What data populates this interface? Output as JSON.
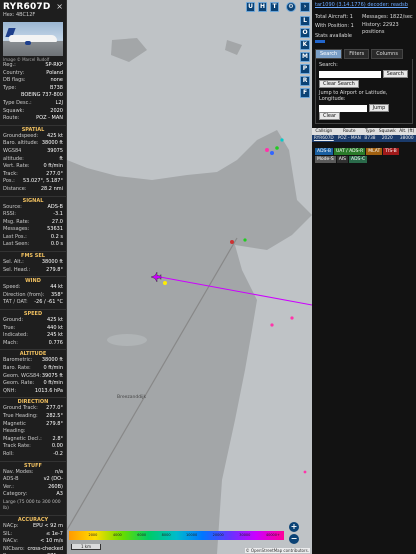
{
  "aircraft": {
    "callsign": "RYR607D",
    "hex_label": "Hex:",
    "hex": "4BC12F",
    "close": "×",
    "photo_credit": "Image © Marcel Rudolf"
  },
  "info_rows": [
    {
      "k": "Reg.:",
      "v": "SP-RKP"
    },
    {
      "k": "Country:",
      "v": "Poland"
    },
    {
      "k": "DB flags:",
      "v": "none"
    },
    {
      "k": "Type:",
      "v": "B738"
    },
    {
      "k": "",
      "v": "BOEING 737-800"
    },
    {
      "k": "Type Desc.:",
      "v": "L2J"
    },
    {
      "k": "Squawk:",
      "v": "2020"
    },
    {
      "k": "Route:",
      "v": "POZ - MAN"
    }
  ],
  "sections": {
    "spatial": {
      "title": "SPATIAL",
      "rows": [
        {
          "k": "Groundspeed:",
          "v": "425 kt"
        },
        {
          "k": "Baro. altitude:",
          "v": "38000 ft"
        },
        {
          "k": "WGS84 altitude:",
          "v": "39075 ft"
        },
        {
          "k": "Vert. Rate:",
          "v": "0 ft/min"
        },
        {
          "k": "Track:",
          "v": "277.0°"
        },
        {
          "k": "Pos.:",
          "v": "53.027°, 5.187°"
        },
        {
          "k": "Distance:",
          "v": "28.2 nmi"
        }
      ]
    },
    "signal": {
      "title": "SIGNAL",
      "rows": [
        {
          "k": "Source:",
          "v": "ADS-B"
        },
        {
          "k": "RSSI:",
          "v": "-3.1"
        },
        {
          "k": "Msg. Rate:",
          "v": "27.0"
        },
        {
          "k": "Messages:",
          "v": "53631"
        },
        {
          "k": "Last Pos.:",
          "v": "0.2 s"
        },
        {
          "k": "Last Seen:",
          "v": "0.0 s"
        }
      ]
    },
    "fms": {
      "title": "FMS SEL",
      "rows": [
        {
          "k": "Sel. Alt.:",
          "v": "38000 ft"
        },
        {
          "k": "Sel. Head.:",
          "v": "279.8°"
        }
      ]
    },
    "wind": {
      "title": "WIND",
      "rows": [
        {
          "k": "Speed:",
          "v": "44 kt"
        },
        {
          "k": "Direction (from):",
          "v": "358°"
        },
        {
          "k": "TAT / OAT:",
          "v": "-26 / -61 °C"
        }
      ]
    },
    "speed": {
      "title": "SPEED",
      "rows": [
        {
          "k": "Ground:",
          "v": "425 kt"
        },
        {
          "k": "True:",
          "v": "440 kt"
        },
        {
          "k": "Indicated:",
          "v": "245 kt"
        },
        {
          "k": "Mach:",
          "v": "0.776"
        }
      ]
    },
    "altitude": {
      "title": "ALTITUDE",
      "rows": [
        {
          "k": "Barometric:",
          "v": "38000 ft"
        },
        {
          "k": "Baro. Rate:",
          "v": "0 ft/min"
        },
        {
          "k": "Geom. WGS84:",
          "v": "39075 ft"
        },
        {
          "k": "Geom. Rate:",
          "v": "0 ft/min"
        },
        {
          "k": "QNH:",
          "v": "1013.6 hPa"
        }
      ]
    },
    "direction": {
      "title": "DIRECTION",
      "rows": [
        {
          "k": "Ground Track:",
          "v": "277.0°"
        },
        {
          "k": "True Heading:",
          "v": "282.5°"
        },
        {
          "k": "Magnetic Heading:",
          "v": "279.8°"
        },
        {
          "k": "Magnetic Decl.:",
          "v": "2.8°"
        },
        {
          "k": "Track Rate:",
          "v": "0.00"
        },
        {
          "k": "Roll:",
          "v": "-0.2"
        }
      ]
    },
    "stuff": {
      "title": "STUFF",
      "rows": [
        {
          "k": "Nav. Modes:",
          "v": "n/a"
        },
        {
          "k": "ADS-B Ver.:",
          "v": "v2 (DO-260B)"
        },
        {
          "k": "Category:",
          "v": "A3"
        }
      ],
      "note": "Large (75 000 to 300 000 lb)"
    },
    "accuracy": {
      "title": "ACCURACY",
      "rows": [
        {
          "k": "NACp:",
          "v": "EPU < 92 m"
        },
        {
          "k": "SIL:",
          "v": "≤ 1e-7"
        },
        {
          "k": "NACv:",
          "v": "< 10 m/s"
        },
        {
          "k": "NICbaro:",
          "v": "cross-checked"
        },
        {
          "k": "Rc:",
          "v": "371 m"
        }
      ],
      "note": "Learn more about Mode S data type by hovering over each data label."
    }
  },
  "map": {
    "top_buttons": [
      "U",
      "H",
      "T"
    ],
    "side_buttons": [
      "L",
      "O",
      "K",
      "M",
      "P",
      "R",
      "F"
    ],
    "zoom_in": "+",
    "zoom_out": "−",
    "place_label": "Breezanddijk",
    "altitude_scale": [
      "",
      "2000",
      "4000",
      "6000",
      "8000",
      "10000",
      "20000",
      "30000",
      "40000+"
    ],
    "scale_label": "1 km",
    "attribution": "© OpenStreetMap contributors.",
    "colors": {
      "water": "#a3a6a8",
      "land": "#bfc3c6",
      "track": "#cc00ff"
    }
  },
  "right": {
    "top_line": "tar1090 (3.14.1776) decoder: readsb",
    "total_label": "Total Aircraft: 1",
    "messages_label": "Messages: 1822/sec",
    "with_pos_label": "With Position: 1",
    "history_label": "History: 22923 positions",
    "stats_label": "Stats available",
    "tabs": [
      "Search",
      "Filters",
      "Columns"
    ],
    "search_label": "Search:",
    "search_btn": "Search",
    "clear_btn": "Clear Search",
    "jump_label": "Jump to Airport or Latitude, Longitude:",
    "jump_btn": "Jump",
    "clear2_btn": "Clear",
    "columns": [
      "Callsign",
      "Route",
      "Type",
      "Squawk",
      "Alt. (ft)"
    ],
    "rows": [
      {
        "callsign": "RYR607D",
        "route": "POZ - MAN",
        "type": "B738",
        "squawk": "2020",
        "alt": "38000"
      }
    ],
    "chips": [
      {
        "label": "ADS-B",
        "color": "#1a5fa0"
      },
      {
        "label": "UAT / ADS-R",
        "color": "#2a7a2a"
      },
      {
        "label": "MLAT",
        "color": "#a06010"
      },
      {
        "label": "TIS-B",
        "color": "#a01a1a"
      },
      {
        "label": "Mode-S",
        "color": "#5a5a5a"
      },
      {
        "label": "AIS",
        "color": "#303030"
      },
      {
        "label": "ADS-C",
        "color": "#2a6a4a"
      }
    ]
  }
}
